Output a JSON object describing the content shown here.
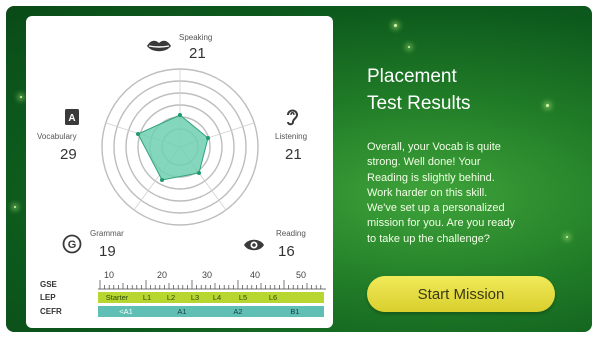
{
  "skills": {
    "speaking": {
      "label": "Speaking",
      "score": "21"
    },
    "listening": {
      "label": "Listening",
      "score": "21"
    },
    "reading": {
      "label": "Reading",
      "score": "16"
    },
    "grammar": {
      "label": "Grammar",
      "score": "19"
    },
    "vocabulary": {
      "label": "Vocabulary",
      "score": "29"
    }
  },
  "scales": {
    "gse_label": "GSE",
    "lep_label": "LEP",
    "cefr_label": "CEFR",
    "gse_ticks": [
      "10",
      "20",
      "30",
      "40",
      "50"
    ],
    "lep_levels": [
      "Starter",
      "L1",
      "L2",
      "L3",
      "L4",
      "L5",
      "L6"
    ],
    "cefr_levels": [
      "<A1",
      "A1",
      "A2",
      "B1"
    ]
  },
  "panel": {
    "title_line1": "Placement",
    "title_line2": "Test Results",
    "description": [
      "Overall, your Vocab is quite",
      "strong. Well done! Your",
      "Reading is slightly behind.",
      "Work harder on this skill.",
      "We've set up a personalized",
      "mission for you. Are you ready",
      "to take up the challenge?"
    ],
    "button_label": "Start Mission"
  },
  "colors": {
    "background": "#1f7a26",
    "radar_fill": "#6fcfb0",
    "radar_stroke": "#2fa27a",
    "lep_bar": "#b7d630",
    "cefr_bar": "#5fbfb4",
    "button": "#e8df45"
  }
}
